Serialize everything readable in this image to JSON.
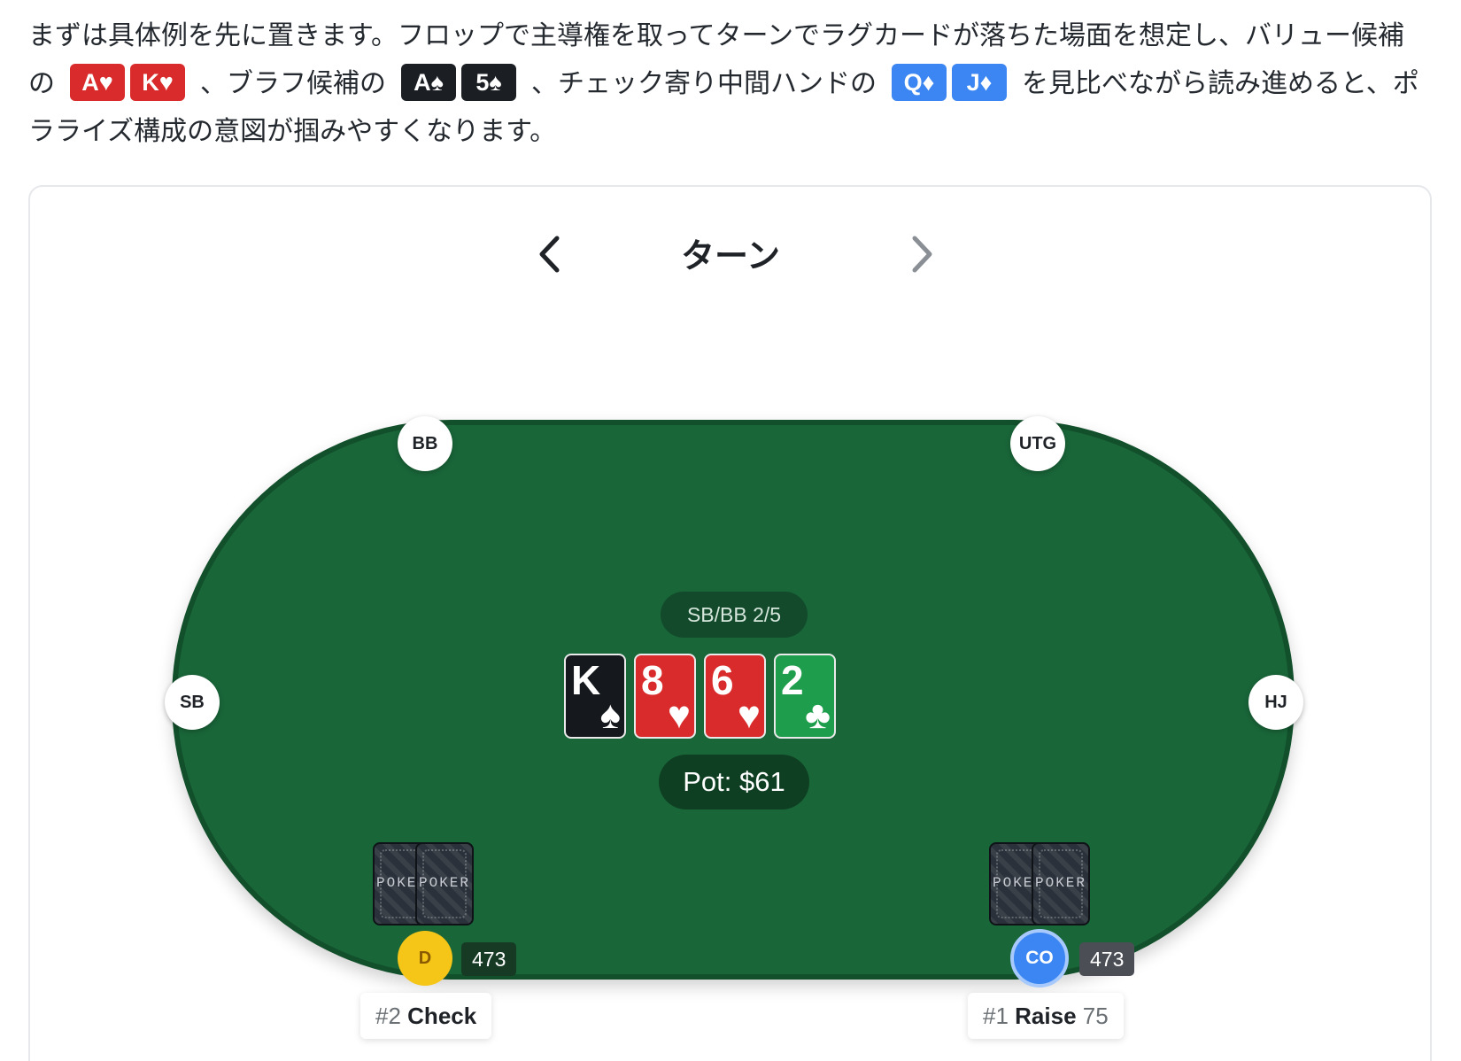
{
  "intro": {
    "text_before": "まずは具体例を先に置きます。フロップで主導権を取ってターンでラグカードが落ちた場面を想定し、バリュー候補の",
    "value_cards": [
      "A♥",
      "K♥"
    ],
    "text_mid1": "、ブラフ候補の",
    "bluff_cards": [
      "A♠",
      "5♠"
    ],
    "text_mid2": "、チェック寄り中間ハンドの",
    "check_cards": [
      "Q♦",
      "J♦"
    ],
    "text_after": "を見比べながら読み進めると、ポラライズ構成の意図が掴みやすくなります。"
  },
  "viewer": {
    "street": "ターン",
    "prev_icon": "chevron-left-icon",
    "next_icon": "chevron-right-icon"
  },
  "table": {
    "seats": {
      "bb": "BB",
      "utg": "UTG",
      "sb": "SB",
      "hj": "HJ"
    },
    "blinds": "SB/BB 2/5",
    "board": [
      {
        "rank": "K",
        "suit": "♠"
      },
      {
        "rank": "8",
        "suit": "♥"
      },
      {
        "rank": "6",
        "suit": "♥"
      },
      {
        "rank": "2",
        "suit": "♣"
      }
    ],
    "pot": "Pot: $61",
    "card_back_text": "POKER",
    "players": {
      "dealer": {
        "label": "D",
        "stack": "473",
        "action_num": "#2",
        "action_verb": "Check"
      },
      "co": {
        "label": "CO",
        "stack": "473",
        "action_num": "#1",
        "action_verb": "Raise",
        "action_amount": "75"
      }
    }
  },
  "colors": {
    "felt": "#196639",
    "felt_border": "#124f2b",
    "heart": "#d92b2b",
    "spade": "#15191e",
    "club": "#1e9e4c",
    "diamond_chip": "#3b86f2",
    "dealer": "#f5c518",
    "co": "#3b86f2"
  }
}
